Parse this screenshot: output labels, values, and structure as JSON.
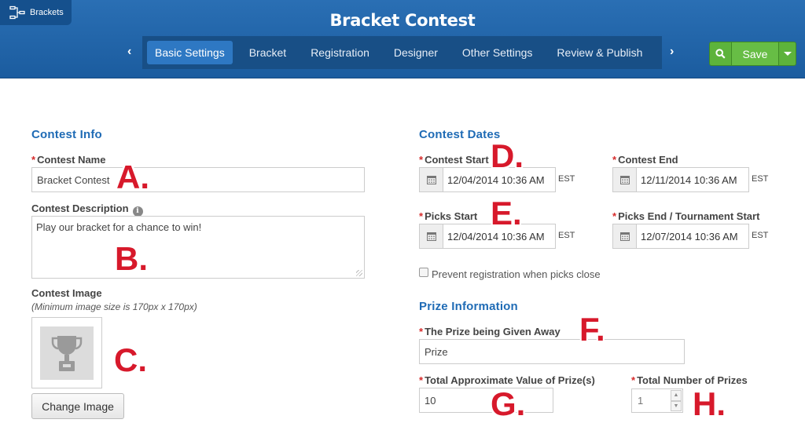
{
  "header": {
    "brand_label": "Brackets",
    "title": "Bracket Contest",
    "tabs": [
      {
        "label": "Basic Settings",
        "active": true
      },
      {
        "label": "Bracket"
      },
      {
        "label": "Registration"
      },
      {
        "label": "Designer"
      },
      {
        "label": "Other Settings"
      },
      {
        "label": "Review & Publish"
      }
    ],
    "save_label": "Save",
    "colors": {
      "header_bg": "#1b5c9f",
      "nav_bg": "#184f86",
      "active_tab": "#2e78c3",
      "save_green": "#67bd45"
    }
  },
  "contest_info": {
    "heading": "Contest Info",
    "name_label": "Contest Name",
    "name_value": "Bracket Contest",
    "description_label": "Contest Description",
    "description_value": "Play our bracket for a chance to win!",
    "image_label": "Contest Image",
    "image_hint": "(Minimum image size is 170px x 170px)",
    "change_image_label": "Change Image"
  },
  "contest_dates": {
    "heading": "Contest Dates",
    "start_label": "Contest Start",
    "start_value": "12/04/2014 10:36 AM",
    "end_label": "Contest End",
    "end_value": "12/11/2014 10:36 AM",
    "picks_start_label": "Picks Start",
    "picks_start_value": "12/04/2014 10:36 AM",
    "picks_end_label": "Picks End / Tournament Start",
    "picks_end_value": "12/07/2014 10:36 AM",
    "timezone": "EST",
    "prevent_label": "Prevent registration when picks close",
    "prevent_checked": false
  },
  "prize_info": {
    "heading": "Prize Information",
    "prize_label": "The Prize being Given Away",
    "prize_value": "Prize",
    "value_label": "Total Approximate Value of Prize(s)",
    "value_value": "10",
    "count_label": "Total Number of Prizes",
    "count_value": "1"
  },
  "annotations": {
    "a": "A.",
    "b": "B.",
    "c": "C.",
    "d": "D.",
    "e": "E.",
    "f": "F.",
    "g": "G.",
    "h": "H."
  },
  "required_mark": "*"
}
